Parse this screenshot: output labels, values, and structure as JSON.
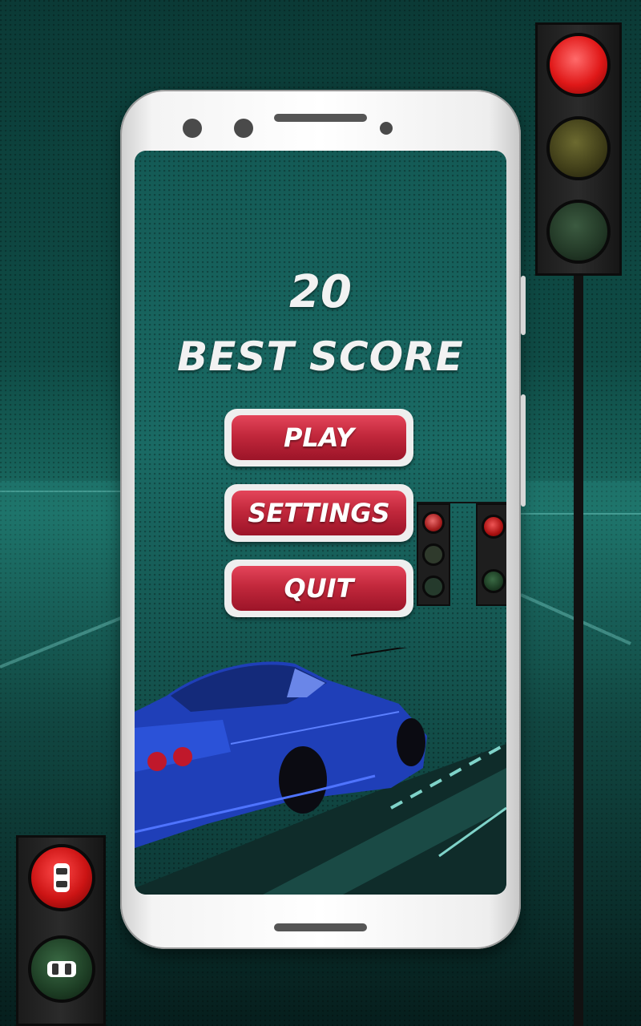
{
  "game": {
    "best_score_value": "20",
    "best_score_label": "BEST SCORE"
  },
  "menu": {
    "play_label": "PLAY",
    "settings_label": "SETTINGS",
    "quit_label": "QUIT"
  },
  "colors": {
    "button_red": "#c2283c",
    "background_teal": "#145a55",
    "light_red": "#ff3b3b",
    "light_yellow_off": "#5a5a22",
    "light_green_off": "#1f4a2a"
  },
  "icons": {
    "traffic_light_large": "traffic-light-icon",
    "car_red_light": "car-icon",
    "car_green_light": "car-icon"
  }
}
